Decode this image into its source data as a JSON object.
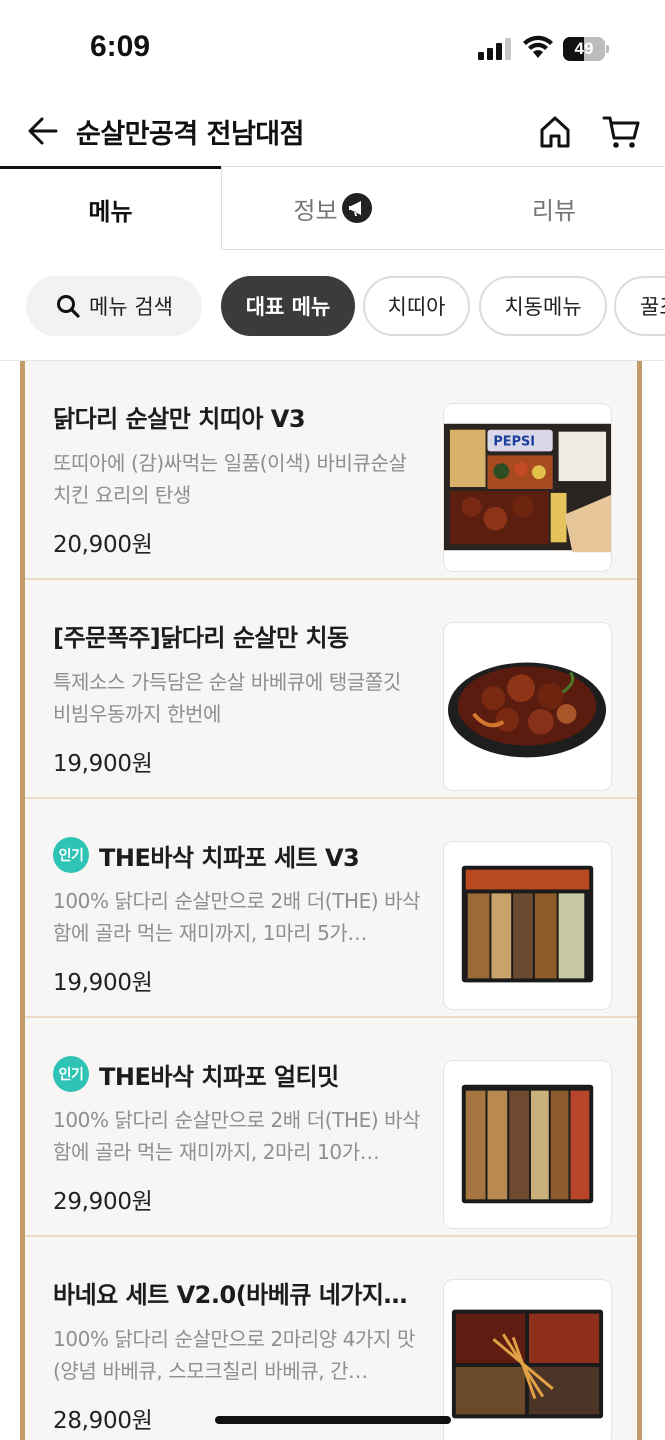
{
  "status_bar": {
    "time": "6:09",
    "battery": "49",
    "battery_level": 0.49
  },
  "header": {
    "title": "순살만공격 전남대점",
    "icons": [
      "back-arrow-icon",
      "home-icon",
      "cart-icon"
    ]
  },
  "tabs": [
    {
      "label": "메뉴",
      "active": true
    },
    {
      "label": "정보",
      "active": false,
      "icon": "megaphone-badge-icon"
    },
    {
      "label": "리뷰",
      "active": false
    }
  ],
  "chips": {
    "search_label": "메뉴 검색",
    "categories": [
      "대표 메뉴",
      "치띠아",
      "치동메뉴",
      "꿀조"
    ]
  },
  "menu_items": [
    {
      "name": "닭다리 순살만 치띠아 V3",
      "popular": false,
      "description": "또띠아에 (감)싸먹는 일품(이색) 바비큐순살 치킨 요리의 탄생",
      "price": "20,900원"
    },
    {
      "name": "[주문폭주]닭다리 순살만 치동",
      "popular": false,
      "description": "특제소스 가득담은 순살 바베큐에 탱글쫄깃 비빔우동까지 한번에",
      "price": "19,900원"
    },
    {
      "name": "THE바삭 치파포 세트 V3",
      "popular": true,
      "badge": "인기",
      "description": "100% 닭다리 순살만으로 2배 더(THE) 바삭함에 골라 먹는 재미까지, 1마리 5가…",
      "price": "19,900원"
    },
    {
      "name": "THE바삭 치파포 얼티밋",
      "popular": true,
      "badge": "인기",
      "description": "100% 닭다리 순살만으로 2배 더(THE) 바삭함에 골라 먹는 재미까지, 2마리 10가…",
      "price": "29,900원"
    },
    {
      "name": "바네요 세트 V2.0(바베큐 네가지…",
      "popular": false,
      "description": "100% 닭다리 순살만으로 2마리양 4가지 맛(양념 바베큐, 스모크칠리 바베큐, 간…",
      "price": "28,900원"
    }
  ],
  "colors": {
    "accent_border": "#c49a6c",
    "popular_badge": "#2fc3b6",
    "active_chip": "#3b3b3b"
  }
}
